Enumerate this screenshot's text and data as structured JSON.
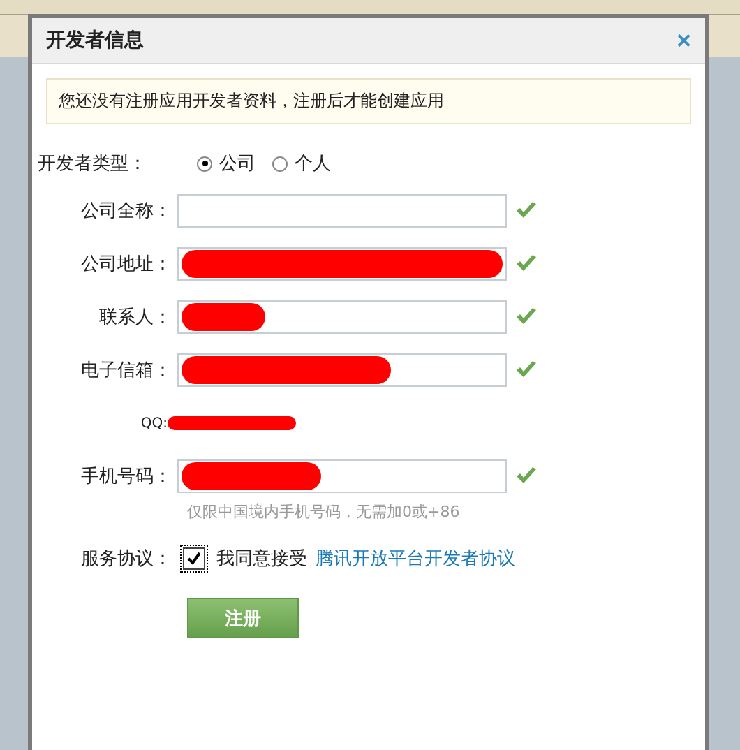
{
  "dialog": {
    "title": "开发者信息",
    "close": "×"
  },
  "notice": "您还没有注册应用开发者资料，注册后才能创建应用",
  "developer_type": {
    "label": "开发者类型：",
    "options": [
      {
        "label": "公司",
        "selected": true
      },
      {
        "label": "个人",
        "selected": false
      }
    ]
  },
  "fields": [
    {
      "kind": "input",
      "label": "公司全称：",
      "redacted": false,
      "valid": true
    },
    {
      "kind": "input",
      "label": "公司地址：",
      "redacted": true,
      "valid": true
    },
    {
      "kind": "input",
      "label": "联系人：",
      "redacted": true,
      "valid": true
    },
    {
      "kind": "input",
      "label": "电子信箱：",
      "redacted": true,
      "valid": true
    },
    {
      "kind": "plain",
      "label": "QQ:",
      "redacted": true,
      "valid": false
    },
    {
      "kind": "input",
      "label": "手机号码：",
      "redacted": true,
      "valid": true,
      "hint": "仅限中国境内手机号码，无需加0或+86"
    }
  ],
  "agreement": {
    "label": "服务协议：",
    "checked": true,
    "text": "我同意接受",
    "link": "腾讯开放平台开发者协议"
  },
  "submit": "注册"
}
